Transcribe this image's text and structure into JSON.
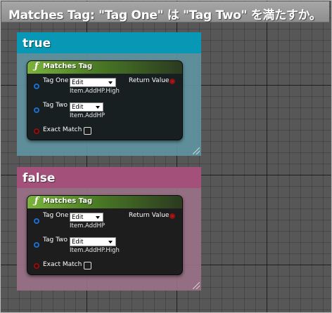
{
  "header": {
    "title": "Matches Tag: \"Tag One\" は \"Tag Two\" を満たすか。"
  },
  "colors": {
    "true_header": "#0897b4",
    "true_body": "#5f95a2",
    "false_header": "#a3507a",
    "false_body": "#9b7187"
  },
  "comments": [
    {
      "title": "true",
      "node": {
        "title": "Matches Tag",
        "icon": "function-icon",
        "tag_one_label": "Tag One",
        "tag_one_edit": "Edit",
        "tag_one_value": "Item.AddHP.High",
        "tag_two_label": "Tag Two",
        "tag_two_edit": "Edit",
        "tag_two_value": "Item.AddHP",
        "exact_match_label": "Exact Match",
        "exact_match_checked": false,
        "return_label": "Return Value"
      }
    },
    {
      "title": "false",
      "node": {
        "title": "Matches Tag",
        "icon": "function-icon",
        "tag_one_label": "Tag One",
        "tag_one_edit": "Edit",
        "tag_one_value": "Item.AddHP",
        "tag_two_label": "Tag Two",
        "tag_two_edit": "Edit",
        "tag_two_value": "Item.AddHP.High",
        "exact_match_label": "Exact Match",
        "exact_match_checked": false,
        "return_label": "Return Value"
      }
    }
  ]
}
